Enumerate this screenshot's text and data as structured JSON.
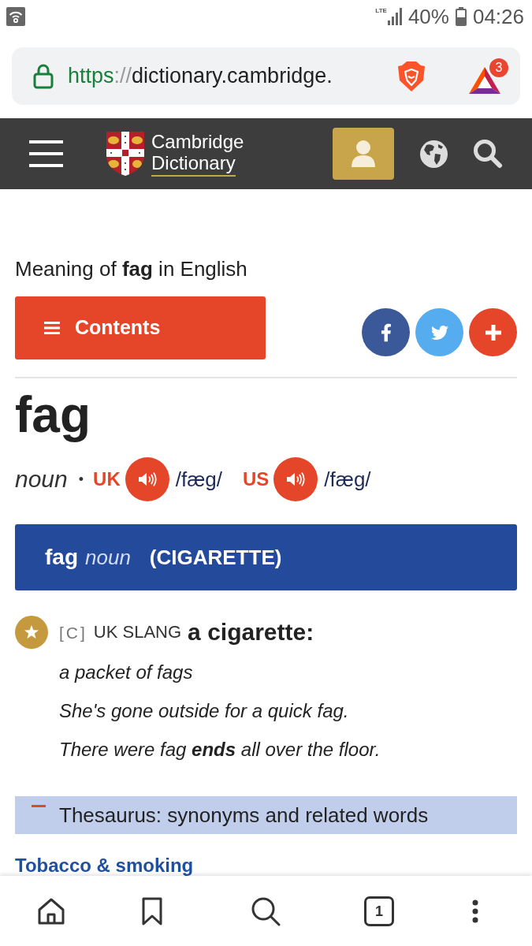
{
  "status_bar": {
    "network": "LTE",
    "battery": "40%",
    "time": "04:26"
  },
  "address_bar": {
    "scheme": "https",
    "separator": "://",
    "host": "dictionary.cambridge.",
    "badge": "3"
  },
  "site_header": {
    "logo_lines": [
      "Cambridge",
      "Dictionary"
    ]
  },
  "page_heading": "Meaning of **fag** in English",
  "contents_button": {
    "label": "Contents"
  },
  "share_buttons": [
    {
      "kind": "facebook"
    },
    {
      "kind": "twitter"
    },
    {
      "kind": "more"
    }
  ],
  "entry": {
    "headword": "fag",
    "part_of_speech": "noun",
    "separator": "•",
    "pronunciations": [
      {
        "region": "UK",
        "ipa": "/fæg/"
      },
      {
        "region": "US",
        "ipa": "/fæg/"
      }
    ]
  },
  "sense": {
    "headword": "fag",
    "part_of_speech": "noun",
    "guideword": "(CIGARETTE)",
    "grammar": "[C]",
    "usage": "UK SLANG",
    "definition": "a cigarette:",
    "examples": [
      "a packet of fags",
      "She's gone outside for a quick fag.",
      "There were fag **ends** all over the floor."
    ]
  },
  "thesaurus": {
    "expanded": true,
    "label": "Thesaurus: synonyms and related words",
    "link": "Tobacco & smoking"
  },
  "bottom_nav": [
    {
      "kind": "home"
    },
    {
      "kind": "bookmark"
    },
    {
      "kind": "search"
    },
    {
      "kind": "tabs",
      "label": "1"
    },
    {
      "kind": "menu"
    }
  ]
}
